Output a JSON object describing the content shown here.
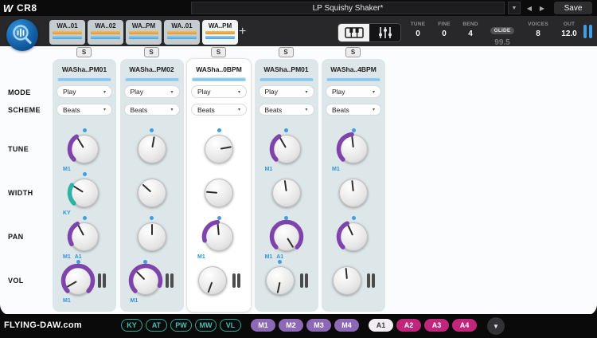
{
  "titlebar": {
    "logo_mark": "W",
    "logo_text": "CR8",
    "preset_name": "LP Squishy Shaker*",
    "save_label": "Save"
  },
  "icons": {
    "preset_menu": "▼",
    "prev": "◀",
    "next": "▶",
    "select_chevron": "▾",
    "collapse": "▼"
  },
  "colors": {
    "accent_blue": "#3d9fe0",
    "purple": "#7e44ab",
    "teal": "#2db3a6",
    "magenta": "#c2267c",
    "tab_orange": "#eda032",
    "tab_blue": "#5fb3e4"
  },
  "tabbar": {
    "add_label": "+",
    "tabs": [
      {
        "label": "WA..01",
        "selected": false
      },
      {
        "label": "WA..02",
        "selected": false
      },
      {
        "label": "WA..PM",
        "selected": false
      },
      {
        "label": "WA..01",
        "selected": false
      },
      {
        "label": "WA..PM",
        "selected": true
      }
    ],
    "globals": [
      {
        "label": "TUNE",
        "value": "0"
      },
      {
        "label": "FINE",
        "value": "0"
      },
      {
        "label": "BEND",
        "value": "4"
      },
      {
        "label": "GLIDE",
        "value": "99.5",
        "pill": true,
        "dim": true
      },
      {
        "label": "VOICES",
        "value": "8"
      },
      {
        "label": "OUT",
        "value": "12.0"
      }
    ]
  },
  "main": {
    "row_labels": [
      "MODE",
      "SCHEME",
      "TUNE",
      "WIDTH",
      "PAN",
      "VOL"
    ],
    "strips": [
      {
        "name": "WASha..PM01",
        "solo_label": "S",
        "selected": false,
        "mode_value": "Play",
        "scheme_value": "Beats",
        "knobs": {
          "tune": {
            "angle": -32,
            "arc": [
              -135,
              -32
            ],
            "arc_color": "purple",
            "dot": true,
            "labels": [
              "M1"
            ]
          },
          "width": {
            "angle": -58,
            "arc": [
              -135,
              -58
            ],
            "arc_color": "teal",
            "dot": true,
            "labels": [
              "KY"
            ]
          },
          "pan": {
            "angle": -28,
            "arc": [
              -120,
              -28
            ],
            "arc_color": "purple",
            "dot": true,
            "labels": [
              "M1",
              "A1"
            ]
          },
          "vol": {
            "angle": -120,
            "arc": [
              -135,
              135
            ],
            "arc_color": "purple",
            "dot": true,
            "labels": [
              "M1"
            ],
            "meter": true
          }
        }
      },
      {
        "name": "WASha..PM02",
        "solo_label": "S",
        "selected": false,
        "mode_value": "Play",
        "scheme_value": "Beats",
        "knobs": {
          "tune": {
            "angle": 10,
            "dot": true
          },
          "width": {
            "angle": -48
          },
          "pan": {
            "angle": 0,
            "dot": true
          },
          "vol": {
            "angle": -45,
            "arc": [
              -135,
              110
            ],
            "arc_color": "purple",
            "dot": true,
            "labels": [
              "M1"
            ],
            "meter": true
          }
        }
      },
      {
        "name": "WASha..0BPM",
        "solo_label": "S",
        "selected": true,
        "mode_value": "Play",
        "scheme_value": "Beats",
        "knobs": {
          "tune": {
            "angle": 80,
            "dot": true
          },
          "width": {
            "angle": -85
          },
          "pan": {
            "angle": -5,
            "arc": [
              -105,
              -5
            ],
            "arc_color": "purple",
            "dot": true,
            "labels": [
              "M1"
            ]
          },
          "vol": {
            "angle": -160,
            "meter": true
          }
        }
      },
      {
        "name": "WASha..PM01",
        "solo_label": "S",
        "selected": false,
        "mode_value": "Play",
        "scheme_value": "Beats",
        "knobs": {
          "tune": {
            "angle": -30,
            "arc": [
              -135,
              -30
            ],
            "arc_color": "purple",
            "dot": true,
            "labels": [
              "M1"
            ]
          },
          "width": {
            "angle": -8
          },
          "pan": {
            "angle": 148,
            "arc": [
              -135,
              135
            ],
            "arc_color": "purple",
            "dot": true,
            "labels": [
              "M1",
              "A1"
            ]
          },
          "vol": {
            "angle": -168,
            "dot": true,
            "meter": true
          }
        }
      },
      {
        "name": "WASha..4BPM",
        "solo_label": "S",
        "selected": false,
        "mode_value": "Play",
        "scheme_value": "Beats",
        "knobs": {
          "tune": {
            "angle": -6,
            "arc": [
              -135,
              -6
            ],
            "arc_color": "purple",
            "dot": true,
            "labels": [
              "M1"
            ]
          },
          "width": {
            "angle": -6
          },
          "pan": {
            "angle": -25,
            "arc": [
              -135,
              -25
            ],
            "arc_color": "purple",
            "dot": true
          },
          "vol": {
            "angle": -5,
            "meter": true
          }
        }
      }
    ]
  },
  "bottombar": {
    "watermark": "FLYING-DAW.com",
    "pills": [
      {
        "label": "KY",
        "type": "teal"
      },
      {
        "label": "AT",
        "type": "teal"
      },
      {
        "label": "PW",
        "type": "teal"
      },
      {
        "label": "MW",
        "type": "teal"
      },
      {
        "label": "VL",
        "type": "teal"
      },
      {
        "label": "M1",
        "type": "purple",
        "group_start": true
      },
      {
        "label": "M2",
        "type": "purple"
      },
      {
        "label": "M3",
        "type": "purple"
      },
      {
        "label": "M4",
        "type": "purple"
      },
      {
        "label": "A1",
        "type": "white",
        "group_start": true
      },
      {
        "label": "A2",
        "type": "magenta"
      },
      {
        "label": "A3",
        "type": "magenta"
      },
      {
        "label": "A4",
        "type": "magenta"
      }
    ]
  }
}
